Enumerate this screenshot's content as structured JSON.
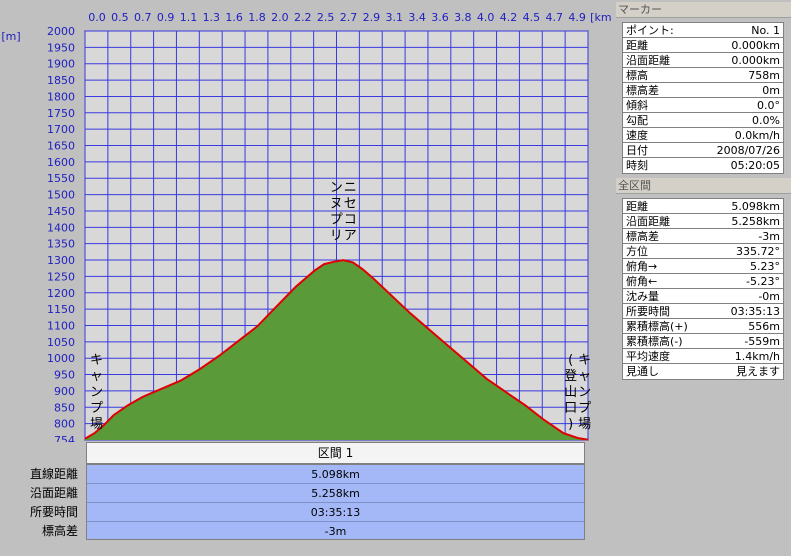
{
  "chart_data": {
    "type": "area",
    "x_unit": "[km]",
    "y_unit": "[m]",
    "x_ticks": [
      "0.0",
      "0.5",
      "0.7",
      "0.9",
      "1.1",
      "1.3",
      "1.6",
      "1.8",
      "2.0",
      "2.2",
      "2.5",
      "2.7",
      "2.9",
      "3.1",
      "3.4",
      "3.6",
      "3.8",
      "4.0",
      "4.2",
      "4.5",
      "4.7",
      "4.9"
    ],
    "y_ticks": [
      2000,
      1950,
      1900,
      1850,
      1800,
      1750,
      1700,
      1650,
      1600,
      1550,
      1500,
      1450,
      1400,
      1350,
      1300,
      1250,
      1200,
      1150,
      1100,
      1050,
      1000,
      950,
      900,
      850,
      800,
      754
    ],
    "xlim": [
      0,
      5.258
    ],
    "ylim": [
      754,
      2000
    ],
    "area_color": "#5a9a38",
    "line_color": "#e00000",
    "grid_color": "#3a3ae0",
    "plot_bg": "#d8d8d8",
    "profile": [
      [
        0.0,
        758
      ],
      [
        0.1,
        775
      ],
      [
        0.2,
        800
      ],
      [
        0.3,
        830
      ],
      [
        0.45,
        860
      ],
      [
        0.6,
        885
      ],
      [
        0.8,
        910
      ],
      [
        1.0,
        935
      ],
      [
        1.2,
        970
      ],
      [
        1.4,
        1010
      ],
      [
        1.6,
        1055
      ],
      [
        1.8,
        1100
      ],
      [
        2.0,
        1160
      ],
      [
        2.2,
        1220
      ],
      [
        2.4,
        1270
      ],
      [
        2.5,
        1290
      ],
      [
        2.6,
        1297
      ],
      [
        2.7,
        1302
      ],
      [
        2.8,
        1295
      ],
      [
        2.9,
        1275
      ],
      [
        3.0,
        1250
      ],
      [
        3.2,
        1195
      ],
      [
        3.4,
        1140
      ],
      [
        3.6,
        1090
      ],
      [
        3.8,
        1040
      ],
      [
        4.0,
        990
      ],
      [
        4.2,
        940
      ],
      [
        4.4,
        900
      ],
      [
        4.6,
        860
      ],
      [
        4.8,
        815
      ],
      [
        5.0,
        775
      ],
      [
        5.15,
        760
      ],
      [
        5.258,
        755
      ]
    ],
    "annotations": [
      {
        "text": "キャンプ場",
        "x": 0.12,
        "y": 900
      },
      {
        "text": "ニセコアンヌプリ",
        "x": 2.7,
        "y": 1450
      },
      {
        "text": "キャンプ場(登山口)",
        "x": 5.15,
        "y": 900
      }
    ]
  },
  "marker": {
    "header": "マーカー",
    "rows": [
      {
        "label": "ポイント:",
        "value": "No. 1"
      },
      {
        "label": "距離",
        "value": "0.000km"
      },
      {
        "label": "沿面距離",
        "value": "0.000km"
      },
      {
        "label": "標高",
        "value": "758m"
      },
      {
        "label": "標高差",
        "value": "0m"
      },
      {
        "label": "傾斜",
        "value": "0.0°"
      },
      {
        "label": "勾配",
        "value": "0.0%"
      },
      {
        "label": "速度",
        "value": "0.0km/h"
      },
      {
        "label": "日付",
        "value": "2008/07/26"
      },
      {
        "label": "時刻",
        "value": "05:20:05"
      }
    ]
  },
  "whole": {
    "header": "全区間",
    "rows": [
      {
        "label": "距離",
        "value": "5.098km"
      },
      {
        "label": "沿面距離",
        "value": "5.258km"
      },
      {
        "label": "標高差",
        "value": "-3m"
      },
      {
        "label": "方位",
        "value": "335.72°"
      },
      {
        "label": "俯角→",
        "value": "5.23°"
      },
      {
        "label": "俯角←",
        "value": "-5.23°"
      },
      {
        "label": "沈み量",
        "value": "-0m"
      },
      {
        "label": "所要時間",
        "value": "03:35:13"
      },
      {
        "label": "累積標高(+)",
        "value": "556m"
      },
      {
        "label": "累積標高(-)",
        "value": "-559m"
      },
      {
        "label": "平均速度",
        "value": "1.4km/h"
      },
      {
        "label": "見通し",
        "value": "見えます"
      }
    ]
  },
  "section": {
    "tab": "区間 1",
    "labels": [
      "直線距離",
      "沿面距離",
      "所要時間",
      "標高差"
    ],
    "values": [
      "5.098km",
      "5.258km",
      "03:35:13",
      "-3m"
    ]
  }
}
